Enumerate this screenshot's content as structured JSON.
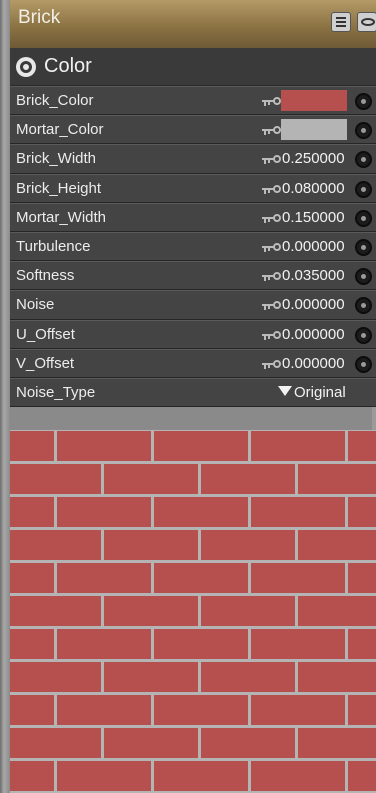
{
  "panel": {
    "title": "Brick"
  },
  "section": {
    "title": "Color"
  },
  "params": [
    {
      "label": "Brick_Color",
      "type": "color",
      "value": "#b5504f"
    },
    {
      "label": "Mortar_Color",
      "type": "color",
      "value": "#b4b4b4"
    },
    {
      "label": "Brick_Width",
      "type": "number",
      "value": "0.250000"
    },
    {
      "label": "Brick_Height",
      "type": "number",
      "value": "0.080000"
    },
    {
      "label": "Mortar_Width",
      "type": "number",
      "value": "0.150000"
    },
    {
      "label": "Turbulence",
      "type": "number",
      "value": "0.000000"
    },
    {
      "label": "Softness",
      "type": "number",
      "value": "0.035000"
    },
    {
      "label": "Noise",
      "type": "number",
      "value": "0.000000"
    },
    {
      "label": "U_Offset",
      "type": "number",
      "value": "0.000000"
    },
    {
      "label": "V_Offset",
      "type": "number",
      "value": "0.000000"
    },
    {
      "label": "Noise_Type",
      "type": "select",
      "value": "Original"
    }
  ],
  "preview": {
    "brick_color": "#b5504f",
    "mortar_color": "#b4b4b4"
  },
  "icons": {
    "menu": "list-icon",
    "view": "eye-icon",
    "section": "target-icon",
    "key": "key-icon",
    "connect": "input-dot-icon",
    "dropdown": "triangle-down-icon"
  }
}
